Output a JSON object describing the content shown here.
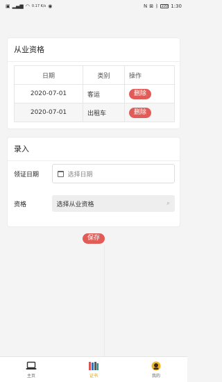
{
  "status_bar": {
    "left_icons": [
      "sim-icon",
      "signal-icon",
      "wifi-icon",
      "data-speed-text",
      "eye-icon"
    ],
    "data_speed": "0.17 K/s",
    "right_icons": [
      "nfc-icon",
      "mute-icon",
      "bluetooth-icon",
      "battery-icon"
    ],
    "battery": "100",
    "time": "1:30"
  },
  "qualification": {
    "title": "从业资格",
    "columns": [
      "日期",
      "类别",
      "操作"
    ],
    "rows": [
      {
        "date": "2020-07-01",
        "type": "客运",
        "action": "删除"
      },
      {
        "date": "2020-07-01",
        "type": "出租车",
        "action": "删除"
      }
    ]
  },
  "entry": {
    "title": "录入",
    "date_label": "领证日期",
    "date_placeholder": "选择日期",
    "qual_label": "资格",
    "qual_placeholder": "选择从业资格"
  },
  "save_label": "保存",
  "bottom_nav": [
    {
      "label": "主页",
      "icon": "laptop-icon",
      "active": false
    },
    {
      "label": "证书",
      "icon": "books-icon",
      "active": true
    },
    {
      "label": "我的",
      "icon": "avatar-icon",
      "active": false
    }
  ],
  "colors": {
    "accent_red": "#e25c57",
    "active_nav": "#d4a017",
    "background": "#f4f4f4"
  }
}
